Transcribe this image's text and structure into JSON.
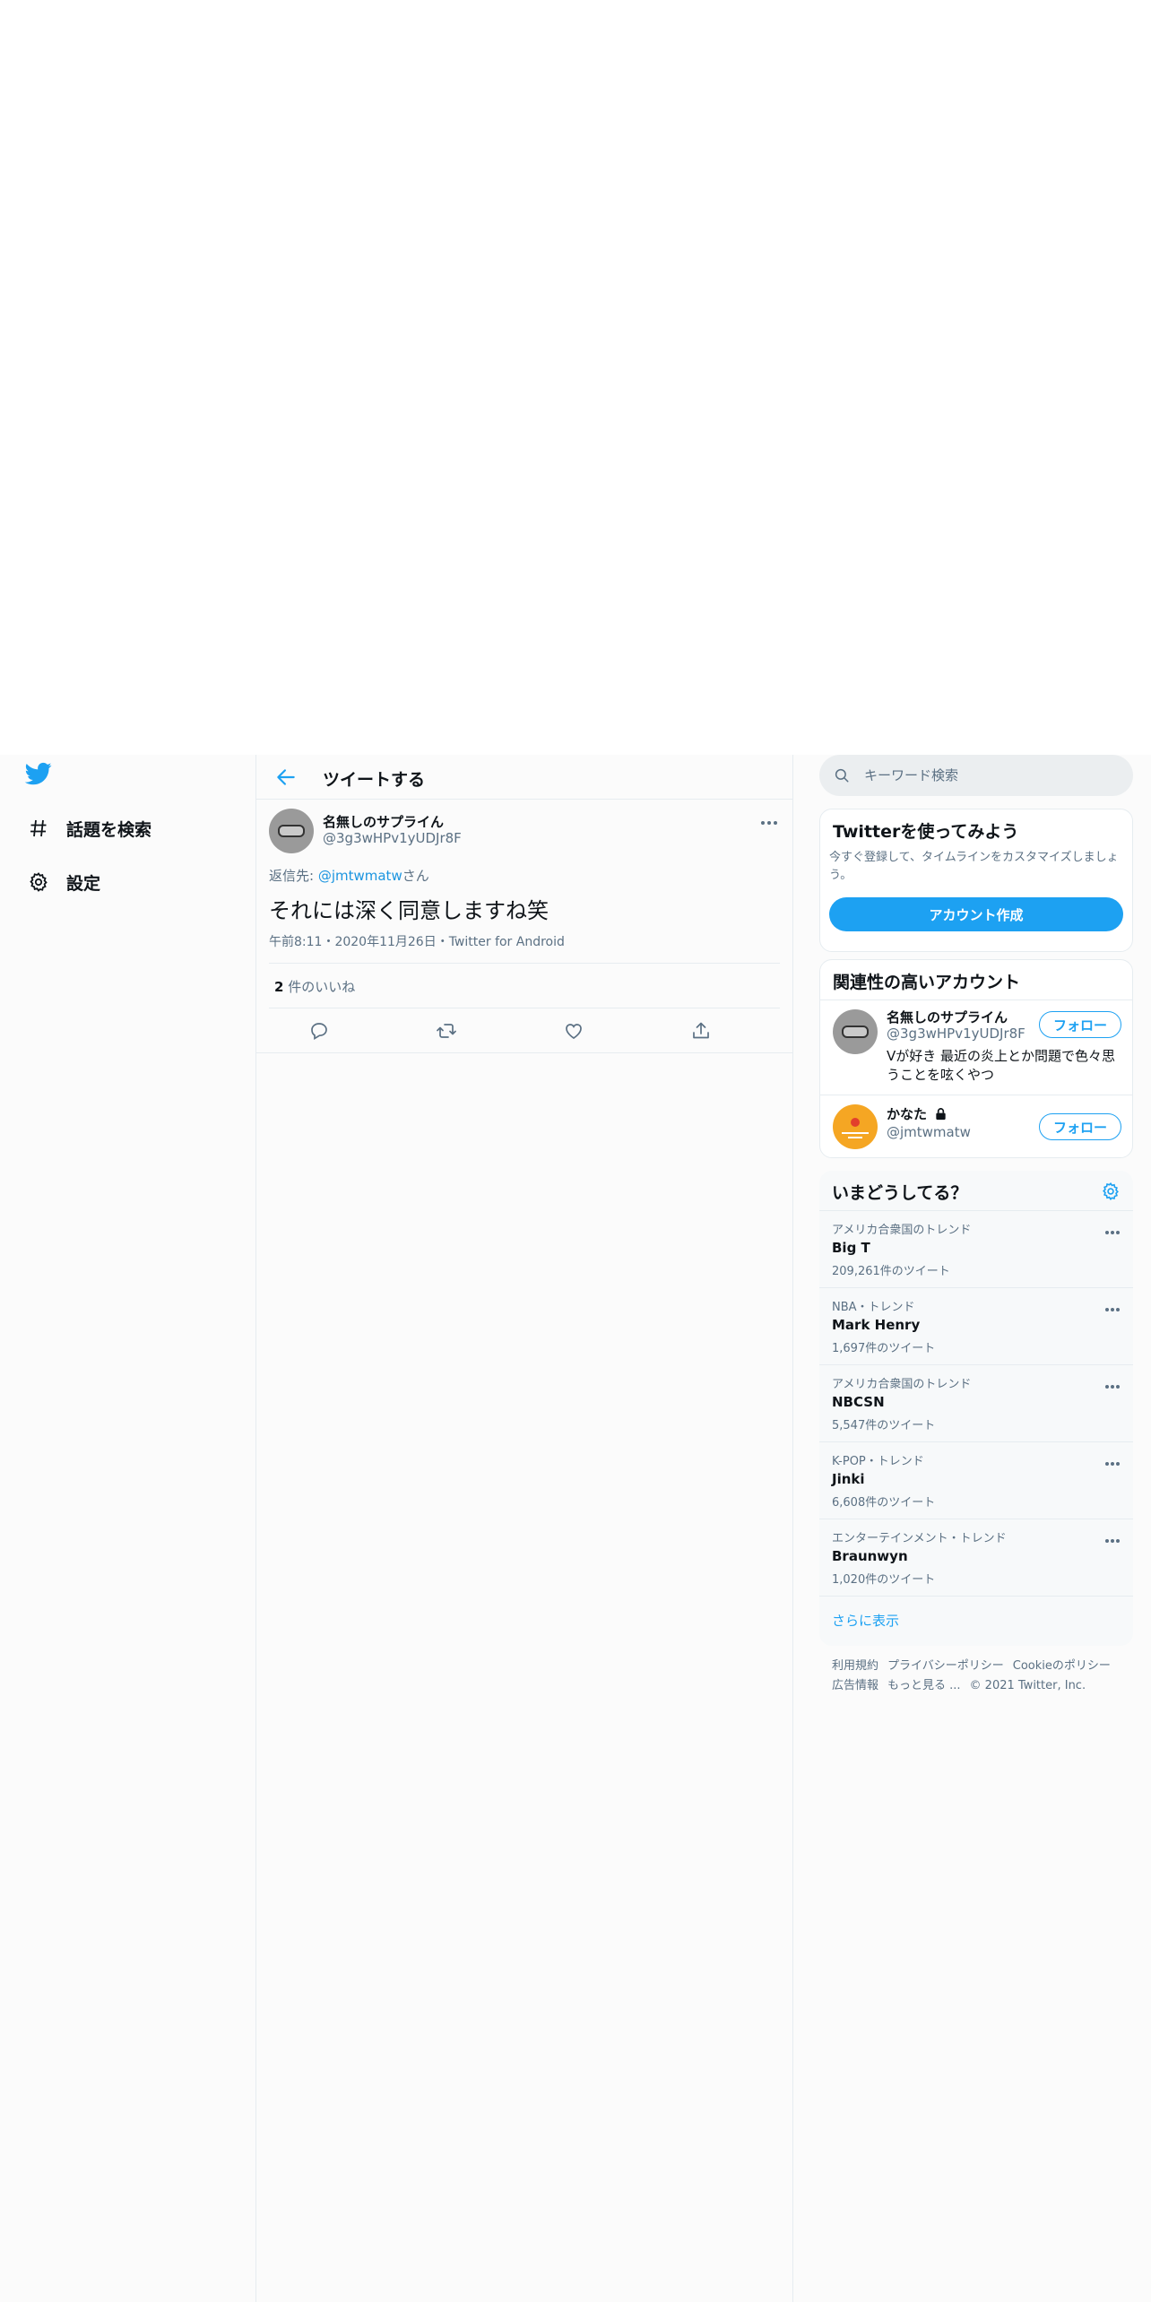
{
  "nav": {
    "items": [
      {
        "label": "話題を検索",
        "icon": "hashtag-icon"
      },
      {
        "label": "設定",
        "icon": "gear-icon"
      }
    ]
  },
  "header": {
    "title": "ツイートする"
  },
  "tweet": {
    "author_name": "名無しのサプライん",
    "author_handle": "@3g3wHPv1yUDJr8F",
    "reply_prefix": "返信先: ",
    "reply_handle": "@jmtwmatw",
    "reply_suffix": "さん",
    "text": "それには深く同意しますね笑",
    "meta": "午前8:11・2020年11月26日・Twitter for Android",
    "likes_count": "2",
    "likes_label": " 件のいいね"
  },
  "search": {
    "placeholder": "キーワード検索"
  },
  "signup": {
    "title": "Twitterを使ってみよう",
    "desc": "今すぐ登録して、タイムラインをカスタマイズしましょう。",
    "button": "アカウント作成"
  },
  "related": {
    "title": "関連性の高いアカウント",
    "accounts": [
      {
        "name": "名無しのサプライん",
        "handle": "@3g3wHPv1yUDJr8F",
        "bio": "Vが好き 最近の炎上とか問題で色々思うことを呟くやつ",
        "follow": "フォロー"
      },
      {
        "name": "かなた",
        "handle": "@jmtwmatw",
        "follow": "フォロー"
      }
    ]
  },
  "trends": {
    "title": "いまどうしてる？",
    "items": [
      {
        "meta": "アメリカ合衆国のトレンド",
        "name": "Big T",
        "count": "209,261件のツイート"
      },
      {
        "meta": "NBA・トレンド",
        "name": "Mark Henry",
        "count": "1,697件のツイート"
      },
      {
        "meta": "アメリカ合衆国のトレンド",
        "name": "NBCSN",
        "count": "5,547件のツイート"
      },
      {
        "meta": "K-POP・トレンド",
        "name": "Jinki",
        "count": "6,608件のツイート"
      },
      {
        "meta": "エンターテインメント・トレンド",
        "name": "Braunwyn",
        "count": "1,020件のツイート"
      }
    ],
    "show_more": "さらに表示"
  },
  "footer": {
    "links": [
      "利用規約",
      "プライバシーポリシー",
      "Cookieのポリシー",
      "広告情報",
      "もっと見る ..."
    ],
    "copyright": "© 2021 Twitter, Inc."
  },
  "colors": {
    "accent": "#1da1f2",
    "text_secondary": "#5b7083",
    "border": "#e6ecf0"
  }
}
